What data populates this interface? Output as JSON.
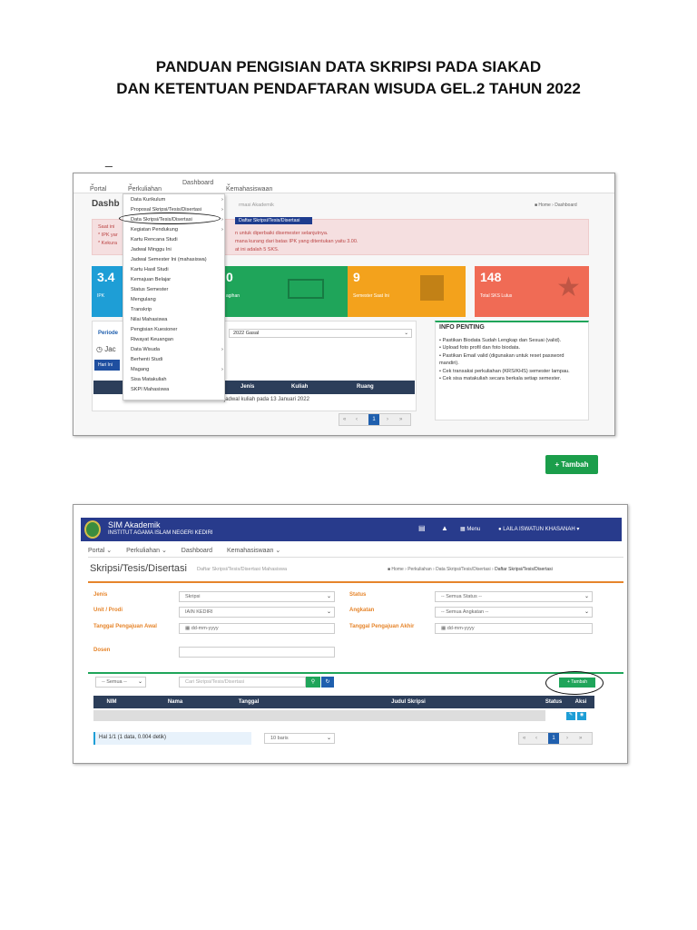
{
  "doc": {
    "title_line1": "PANDUAN PENGISIAN DATA SKRIPSI PADA SIAKAD",
    "title_line2": "DAN KETENTUAN PENDAFTARAN WISUDA GEL.2 TAHUN 2022",
    "dash": "_"
  },
  "shot1": {
    "nav": [
      "Portal",
      "Perkuliahan",
      "Dashboard",
      "Kemahasiswaan"
    ],
    "page_title": "Dashb",
    "subtitle_frag": "rmasi Akademik",
    "crumb": [
      "Home",
      "Dashboard"
    ],
    "alert_lines": [
      "Saat ini",
      "* IPK yar",
      "* Kekura"
    ],
    "alert_frags": [
      "n untuk diperbaiki disemester selanjutnya.",
      "mana kurang dari batas IPK yang ditentukan yaitu 3.00.",
      "at ini adalah 5 SKS."
    ],
    "cards": [
      {
        "big": "3.4",
        "sub": "IPK",
        "color": "#1e9ed6"
      },
      {
        "big": "0",
        "sub": "agihan",
        "color": "#1fa55a"
      },
      {
        "big": "9",
        "sub": "Semester Saat Ini",
        "color": "#f3a21c"
      },
      {
        "big": "148",
        "sub": "Total SKS Lulus",
        "color": "#f06b55"
      }
    ],
    "periode_label": "Periode",
    "periode_value": "2022 Gasal",
    "jadwal_frag": "Jac",
    "hari_btn": "Hari Ini",
    "table_headers": [
      "Jenis",
      "Kuliah",
      "Ruang"
    ],
    "empty_msg": "Tidak ada jadwal kuliah pada 13 Januari 2022",
    "pager": [
      "«",
      "‹",
      "1",
      "›",
      "»"
    ],
    "info": {
      "title": "INFO PENTING",
      "items": [
        "Pastikan Biodata Sudah Lengkap dan Sesuai (valid).",
        "Upload foto profil dan foto biodata.",
        "Pastikan Email valid (digunakan untuk reset password mandiri).",
        "Cek transaksi perkuliahan (KRS/KHS) semester lampau.",
        "Cek sisa matakuliah secara berkala setiap semester."
      ]
    },
    "menu": [
      "Data Kurikulum",
      "Proposal Skripsi/Tesis/Disertasi",
      "Data Skripsi/Tesis/Disertasi",
      "Kegiatan Pendukung",
      "Kartu Rencana Studi",
      "Jadwal Minggu Ini",
      "Jadwal Semester Ini (mahasiswa)",
      "Kartu Hasil Studi",
      "Kemajuan Belajar",
      "Status Semester",
      "Mengulang",
      "Transkrip",
      "Nilai Mahasiswa",
      "Pengisian Kuesioner",
      "Riwayat Keuangan",
      "Data Wisuda",
      "Berhenti Studi",
      "Magang",
      "Sisa Matakuliah",
      "SKPI Mahasiswa"
    ],
    "submenu": "Daftar Skripsi/Tesis/Disertasi"
  },
  "button": {
    "label": "+ Tambah"
  },
  "shot2": {
    "app_title": "SIM Akademik",
    "app_sub": "INSTITUT AGAMA ISLAM NEGERI KEDIRI",
    "menu_label": "Menu",
    "user": "LAILA ISWATUN KHASANAH",
    "nav": [
      "Portal",
      "Perkuliahan",
      "Dashboard",
      "Kemahasiswaan"
    ],
    "page_title": "Skripsi/Tesis/Disertasi",
    "page_sub": "Daftar Skripsi/Tesis/Disertasi Mahasiswa",
    "crumb": [
      "Home",
      "Perkuliahan",
      "Data Skripsi/Tesis/Disertasi",
      "Daftar Skripsi/Tesis/Disertasi"
    ],
    "f_jenis": "Jenis",
    "v_jenis": "Skripsi",
    "f_unit": "Unit / Prodi",
    "v_unit": "IAIN KEDIRI",
    "f_tgl_awal": "Tanggal Pengajuan Awal",
    "v_tgl_awal": "dd-mm-yyyy",
    "f_dosen": "Dosen",
    "f_status": "Status",
    "v_status": "-- Semua Status --",
    "f_angkatan": "Angkatan",
    "v_angkatan": "-- Semua Angkatan --",
    "f_tgl_akhir": "Tanggal Pengajuan Akhir",
    "v_tgl_akhir": "dd-mm-yyyy",
    "semua": "-- Semua --",
    "search_ph": "Cari Skripsi/Tesis/Disertasi",
    "tambah": "+ Tambah",
    "headers": [
      "NIM",
      "Nama",
      "Tanggal",
      "Judul Skripsi",
      "Status",
      "Aksi"
    ],
    "footer": "Hal 1/1 (1 data, 0.004 detik)",
    "rows": "10 baris",
    "pager": [
      "«",
      "‹",
      "1",
      "›",
      "»"
    ]
  }
}
